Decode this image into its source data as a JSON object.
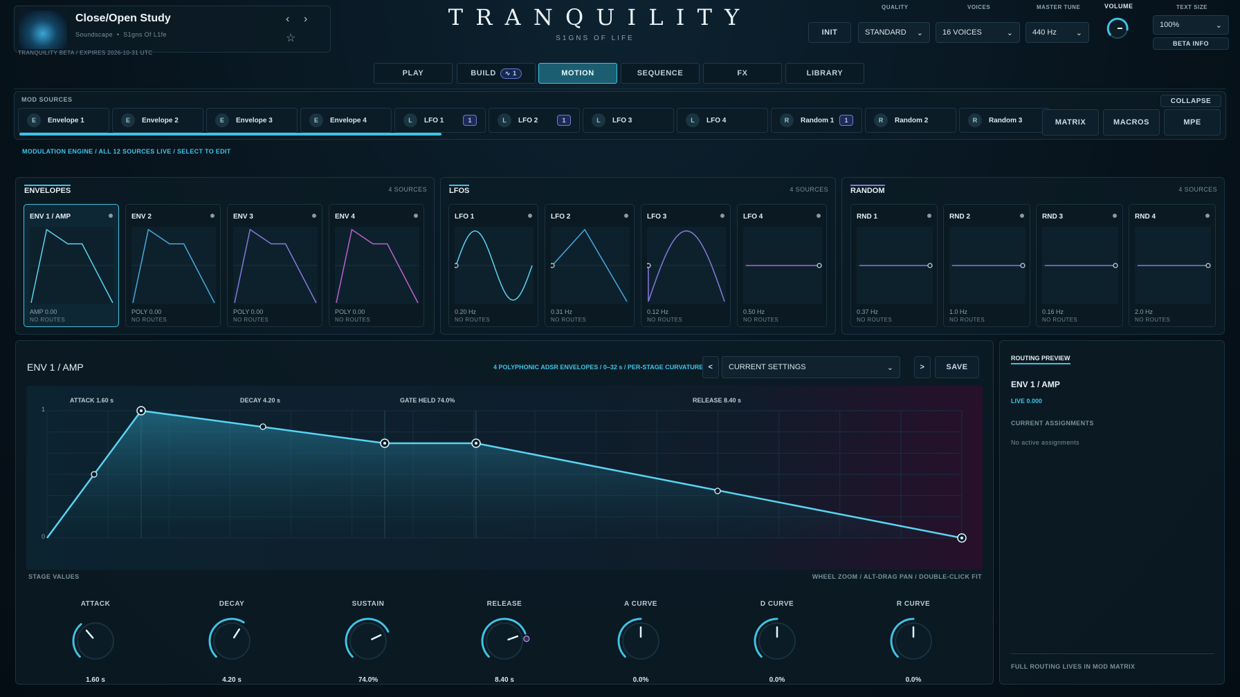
{
  "preset": {
    "name": "Close/Open Study",
    "category": "Soundscape",
    "bank": "S1gns Of L1fe",
    "beta_notice": "TRANQUILITY BETA / EXPIRES 2026-10-31 UTC"
  },
  "brand": {
    "title": "T R A N Q U I L I T Y",
    "subtitle": "S1GNS OF LIFE"
  },
  "header": {
    "init_label": "INIT",
    "quality_label": "QUALITY",
    "quality_value": "STANDARD",
    "voices_label": "VOICES",
    "voices_value": "16 VOICES",
    "tune_label": "MASTER TUNE",
    "tune_value": "440 Hz",
    "volume_label": "VOLUME",
    "text_size_label": "TEXT SIZE",
    "text_size_value": "100%",
    "beta_info": "BETA INFO"
  },
  "tabs": [
    {
      "label": "PLAY"
    },
    {
      "label": "BUILD",
      "badge": "1"
    },
    {
      "label": "MOTION"
    },
    {
      "label": "SEQUENCE"
    },
    {
      "label": "FX"
    },
    {
      "label": "LIBRARY"
    }
  ],
  "mod_sources": {
    "title": "MOD SOURCES",
    "collapse": "COLLAPSE",
    "matrix": "MATRIX",
    "macros": "MACROS",
    "mpe": "MPE",
    "chips": [
      {
        "tag": "E",
        "label": "Envelope 1"
      },
      {
        "tag": "E",
        "label": "Envelope 2"
      },
      {
        "tag": "E",
        "label": "Envelope 3"
      },
      {
        "tag": "E",
        "label": "Envelope 4"
      },
      {
        "tag": "L",
        "label": "LFO 1",
        "badge": "1"
      },
      {
        "tag": "L",
        "label": "LFO 2",
        "badge": "1"
      },
      {
        "tag": "L",
        "label": "LFO 3"
      },
      {
        "tag": "L",
        "label": "LFO 4"
      },
      {
        "tag": "R",
        "label": "Random 1",
        "badge": "1"
      },
      {
        "tag": "R",
        "label": "Random 2"
      },
      {
        "tag": "R",
        "label": "Random 3"
      }
    ]
  },
  "breadcrumb": "MODULATION ENGINE / ALL 12 SOURCES LIVE / SELECT TO EDIT",
  "groups": [
    {
      "title": "ENVELOPES",
      "count": "4 SOURCES"
    },
    {
      "title": "LFOS",
      "count": "4 SOURCES"
    },
    {
      "title": "RANDOM",
      "count": "4 SOURCES"
    }
  ],
  "cards": [
    {
      "title": "ENV 1 / AMP",
      "value": "AMP  0.00",
      "routes": "NO ROUTES"
    },
    {
      "title": "ENV 2",
      "value": "POLY  0.00",
      "routes": "NO ROUTES"
    },
    {
      "title": "ENV 3",
      "value": "POLY  0.00",
      "routes": "NO ROUTES"
    },
    {
      "title": "ENV 4",
      "value": "POLY  0.00",
      "routes": "NO ROUTES"
    },
    {
      "title": "LFO 1",
      "value": "0.20 Hz",
      "routes": "NO ROUTES"
    },
    {
      "title": "LFO 2",
      "value": "0.31 Hz",
      "routes": "NO ROUTES"
    },
    {
      "title": "LFO 3",
      "value": "0.12 Hz",
      "routes": "NO ROUTES"
    },
    {
      "title": "LFO 4",
      "value": "0.50 Hz",
      "routes": "NO ROUTES"
    },
    {
      "title": "RND 1",
      "value": "0.37 Hz",
      "routes": "NO ROUTES"
    },
    {
      "title": "RND 2",
      "value": "1.0 Hz",
      "routes": "NO ROUTES"
    },
    {
      "title": "RND 3",
      "value": "0.16 Hz",
      "routes": "NO ROUTES"
    },
    {
      "title": "RND 4",
      "value": "2.0 Hz",
      "routes": "NO ROUTES"
    }
  ],
  "editor": {
    "title": "ENV 1  /  AMP",
    "info": "4 POLYPHONIC ADSR ENVELOPES  /  0–32 s  /  PER-STAGE CURVATURE",
    "preset_value": "CURRENT SETTINGS",
    "save": "SAVE",
    "prev": "<",
    "next": ">",
    "stage_labels": {
      "attack": "ATTACK  1.60 s",
      "decay": "DECAY  4.20 s",
      "gate": "GATE HELD  74.0%",
      "release": "RELEASE  8.40 s"
    },
    "y_max": "1",
    "y_min": "0",
    "stage_values": "STAGE VALUES",
    "hint": "WHEEL ZOOM  /  ALT-DRAG PAN  /  DOUBLE-CLICK FIT"
  },
  "knobs": [
    {
      "label": "ATTACK",
      "value": "1.60 s",
      "level": 0.35
    },
    {
      "label": "DECAY",
      "value": "4.20 s",
      "level": 0.62
    },
    {
      "label": "SUSTAIN",
      "value": "74.0%",
      "level": 0.74
    },
    {
      "label": "RELEASE",
      "value": "8.40 s",
      "level": 0.76
    },
    {
      "label": "A CURVE",
      "value": "0.0%",
      "level": 0.5
    },
    {
      "label": "D CURVE",
      "value": "0.0%",
      "level": 0.5
    },
    {
      "label": "R CURVE",
      "value": "0.0%",
      "level": 0.5
    }
  ],
  "routing": {
    "title": "ROUTING PREVIEW",
    "source": "ENV 1 / AMP",
    "live": "LIVE  0.000",
    "assign_title": "CURRENT ASSIGNMENTS",
    "assign_value": "No active assignments",
    "footer": "FULL ROUTING LIVES IN MOD MATRIX"
  }
}
